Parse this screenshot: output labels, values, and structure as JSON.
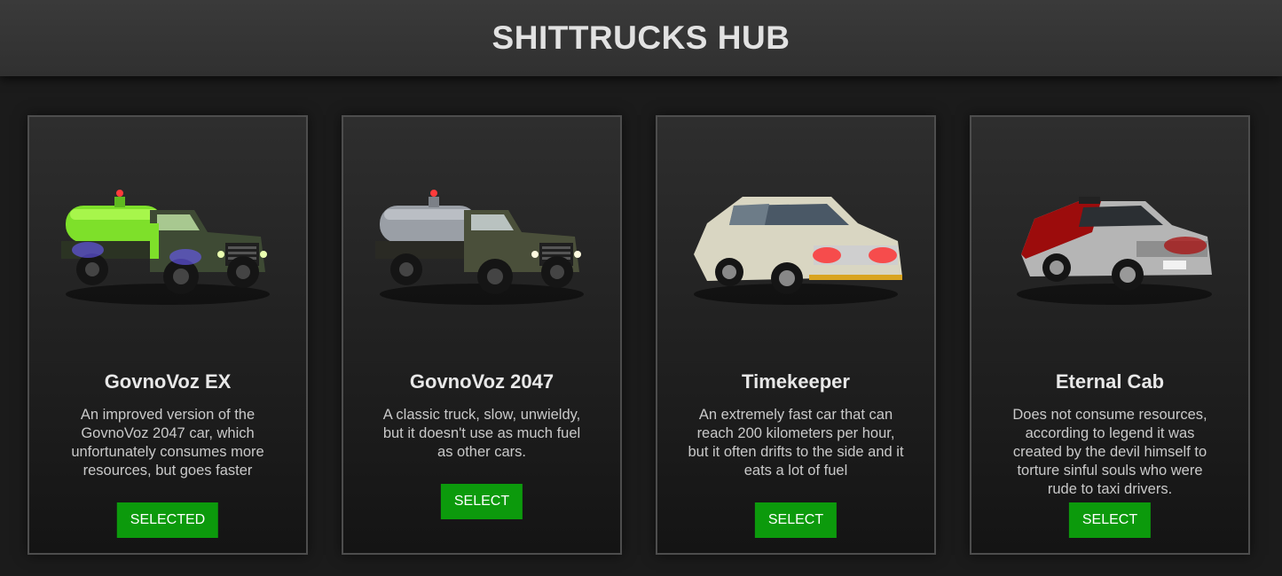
{
  "header": {
    "title": "SHITTRUCKS HUB"
  },
  "cars": [
    {
      "name": "GovnoVoz EX",
      "description": "An improved version of the GovnoVoz 2047 car, which unfortunately consumes more resources, but goes faster",
      "button_label": "SELECTED",
      "image": "green-neon-tank-truck"
    },
    {
      "name": "GovnoVoz 2047",
      "description": "A classic truck, slow, unwieldy, but it doesn't use as much fuel as other cars.",
      "button_label": "SELECT",
      "image": "olive-tank-truck"
    },
    {
      "name": "Timekeeper",
      "description": "An extremely fast car that can reach 200 kilometers per hour, but it often drifts to the side and it eats a lot of fuel",
      "button_label": "SELECT",
      "image": "silver-sports-coupe"
    },
    {
      "name": "Eternal Cab",
      "description": "Does not consume resources, according to legend it was created by the devil himself to torture sinful souls who were rude to taxi drivers.",
      "button_label": "SELECT",
      "image": "bloody-taxi-car"
    }
  ],
  "colors": {
    "accent": "#0c9a0c",
    "background": "#1b1b1b",
    "header": "#333333",
    "card_border": "#4d4d4d"
  }
}
